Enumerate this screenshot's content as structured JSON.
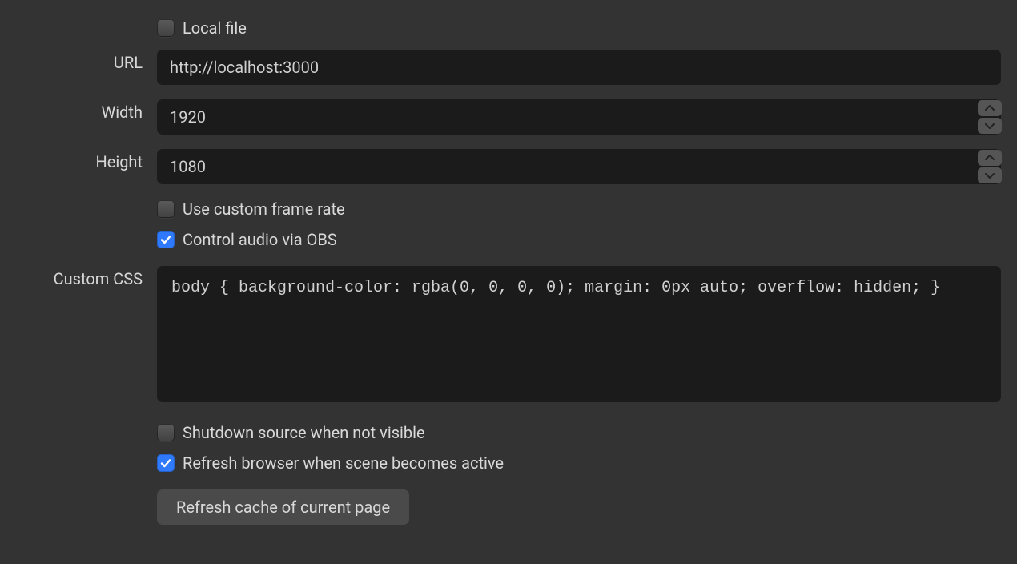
{
  "localFile": {
    "label": "Local file",
    "checked": false
  },
  "url": {
    "label": "URL",
    "value": "http://localhost:3000"
  },
  "width": {
    "label": "Width",
    "value": "1920"
  },
  "height": {
    "label": "Height",
    "value": "1080"
  },
  "customFrameRate": {
    "label": "Use custom frame rate",
    "checked": false
  },
  "controlAudio": {
    "label": "Control audio via OBS",
    "checked": true
  },
  "customCss": {
    "label": "Custom CSS",
    "value": "body { background-color: rgba(0, 0, 0, 0); margin: 0px auto; overflow: hidden; }"
  },
  "shutdown": {
    "label": "Shutdown source when not visible",
    "checked": false
  },
  "refreshActive": {
    "label": "Refresh browser when scene becomes active",
    "checked": true
  },
  "refreshCacheButton": "Refresh cache of current page"
}
